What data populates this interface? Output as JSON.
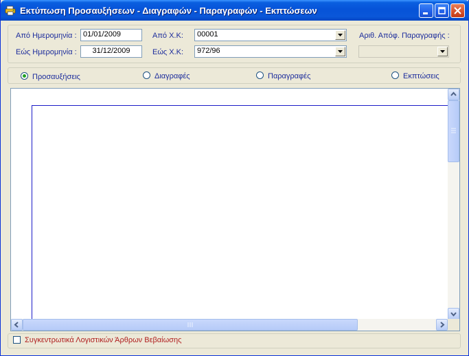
{
  "window": {
    "title": "Εκτύπωση Προσαυξήσεων - Διαγραφών - Παραγραφών - Εκπτώσεων",
    "icon": "printer-app-icon"
  },
  "filters": {
    "from_date_label": "Από Ημερομηνία :",
    "from_date_value": "01/01/2009",
    "to_date_label": "Εώς Ημερομηνία :",
    "to_date_value": "31/12/2009",
    "from_xk_label": "Από Χ.Κ:",
    "from_xk_value": "00001",
    "to_xk_label": "Εώς Χ.Κ:",
    "to_xk_value": "972/96",
    "decision_label": "Αριθ. Απόφ. Παραγραφής :",
    "decision_value": ""
  },
  "options": {
    "selected": "increases",
    "items": [
      {
        "id": "increases",
        "label": "Προσαυξήσεις"
      },
      {
        "id": "deletions",
        "label": "Διαγραφές"
      },
      {
        "id": "prescriptions",
        "label": "Παραγραφές"
      },
      {
        "id": "discounts",
        "label": "Εκπτώσεις"
      }
    ]
  },
  "footer": {
    "summary_label": "Συγκεντρωτικά Λογιστικών Άρθρων Βεβαίωσης",
    "summary_checked": false
  }
}
